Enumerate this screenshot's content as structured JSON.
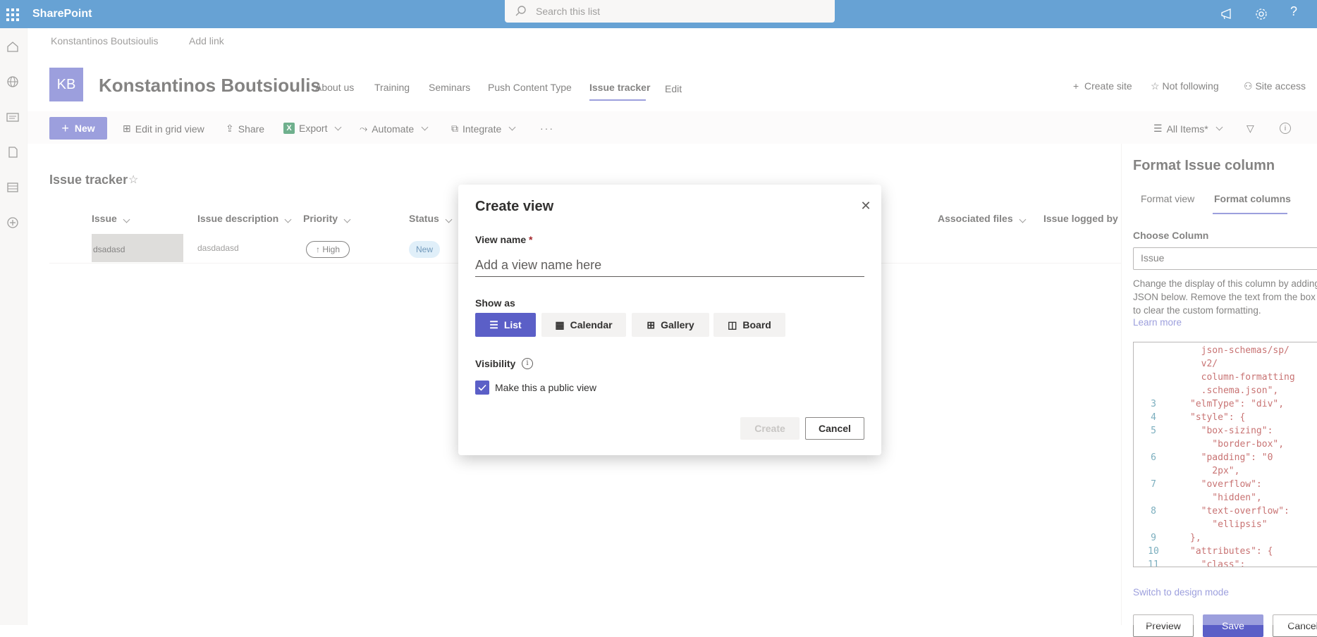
{
  "suite": {
    "app_name": "SharePoint",
    "search_placeholder": "Search this list"
  },
  "hub_nav": {
    "items": [
      "Konstantinos Boutsioulis",
      "Add link"
    ]
  },
  "site": {
    "logo_initials": "KB",
    "title": "Konstantinos Boutsioulis",
    "nav": [
      "About us",
      "Training",
      "Seminars",
      "Push Content Type",
      "Issue tracker",
      "Edit"
    ],
    "active_nav": "Issue tracker",
    "actions": [
      "Create site",
      "Not following",
      "Site access"
    ]
  },
  "commandbar": {
    "new_label": "New",
    "items": [
      "Edit in grid view",
      "Share",
      "Export",
      "Automate",
      "Integrate"
    ],
    "view_selector": "All Items*"
  },
  "list": {
    "title": "Issue tracker",
    "columns": [
      "Issue",
      "Issue description",
      "Priority",
      "Status",
      "Associated files",
      "Issue logged by"
    ],
    "rows": [
      {
        "issue": "dsadasd",
        "description": "dasdadasd",
        "priority": "↑ High",
        "status": "New"
      }
    ]
  },
  "panel": {
    "title": "Format Issue column",
    "tabs": [
      "Format view",
      "Format columns"
    ],
    "active_tab": "Format columns",
    "choose_column_label": "Choose Column",
    "selected_column": "Issue",
    "description": "Change the display of this column by adding JSON below. Remove the text from the box to clear the custom formatting.",
    "learn_more": "Learn more",
    "code_lines": [
      {
        "n": "",
        "t": "  json-schemas/sp/"
      },
      {
        "n": "",
        "t": "  v2/"
      },
      {
        "n": "",
        "t": "  column-formatting"
      },
      {
        "n": "",
        "t": "  .schema.json\","
      },
      {
        "n": "3",
        "t": "\"elmType\": \"div\","
      },
      {
        "n": "4",
        "t": "\"style\": {"
      },
      {
        "n": "5",
        "t": "  \"box-sizing\":"
      },
      {
        "n": "",
        "t": "    \"border-box\","
      },
      {
        "n": "6",
        "t": "  \"padding\": \"0"
      },
      {
        "n": "",
        "t": "    2px\","
      },
      {
        "n": "7",
        "t": "  \"overflow\":"
      },
      {
        "n": "",
        "t": "    \"hidden\","
      },
      {
        "n": "8",
        "t": "  \"text-overflow\":"
      },
      {
        "n": "",
        "t": "    \"ellipsis\""
      },
      {
        "n": "9",
        "t": "},"
      },
      {
        "n": "10",
        "t": "\"attributes\": {"
      },
      {
        "n": "11",
        "t": "  \"class\":"
      }
    ],
    "switch_design": "Switch to design mode",
    "buttons": [
      "Preview",
      "Save",
      "Cancel"
    ]
  },
  "dialog": {
    "title": "Create view",
    "view_name_label": "View name",
    "required_marker": "*",
    "view_name_placeholder": "Add a view name here",
    "view_name_value": "",
    "show_as_label": "Show as",
    "show_as_options": [
      "List",
      "Calendar",
      "Gallery",
      "Board"
    ],
    "selected_show_as": "List",
    "visibility_label": "Visibility",
    "public_view_label": "Make this a public view",
    "public_view_checked": true,
    "create_label": "Create",
    "cancel_label": "Cancel"
  },
  "colors": {
    "suite_bar": "#0364b8",
    "accent": "#5b5fc7"
  }
}
